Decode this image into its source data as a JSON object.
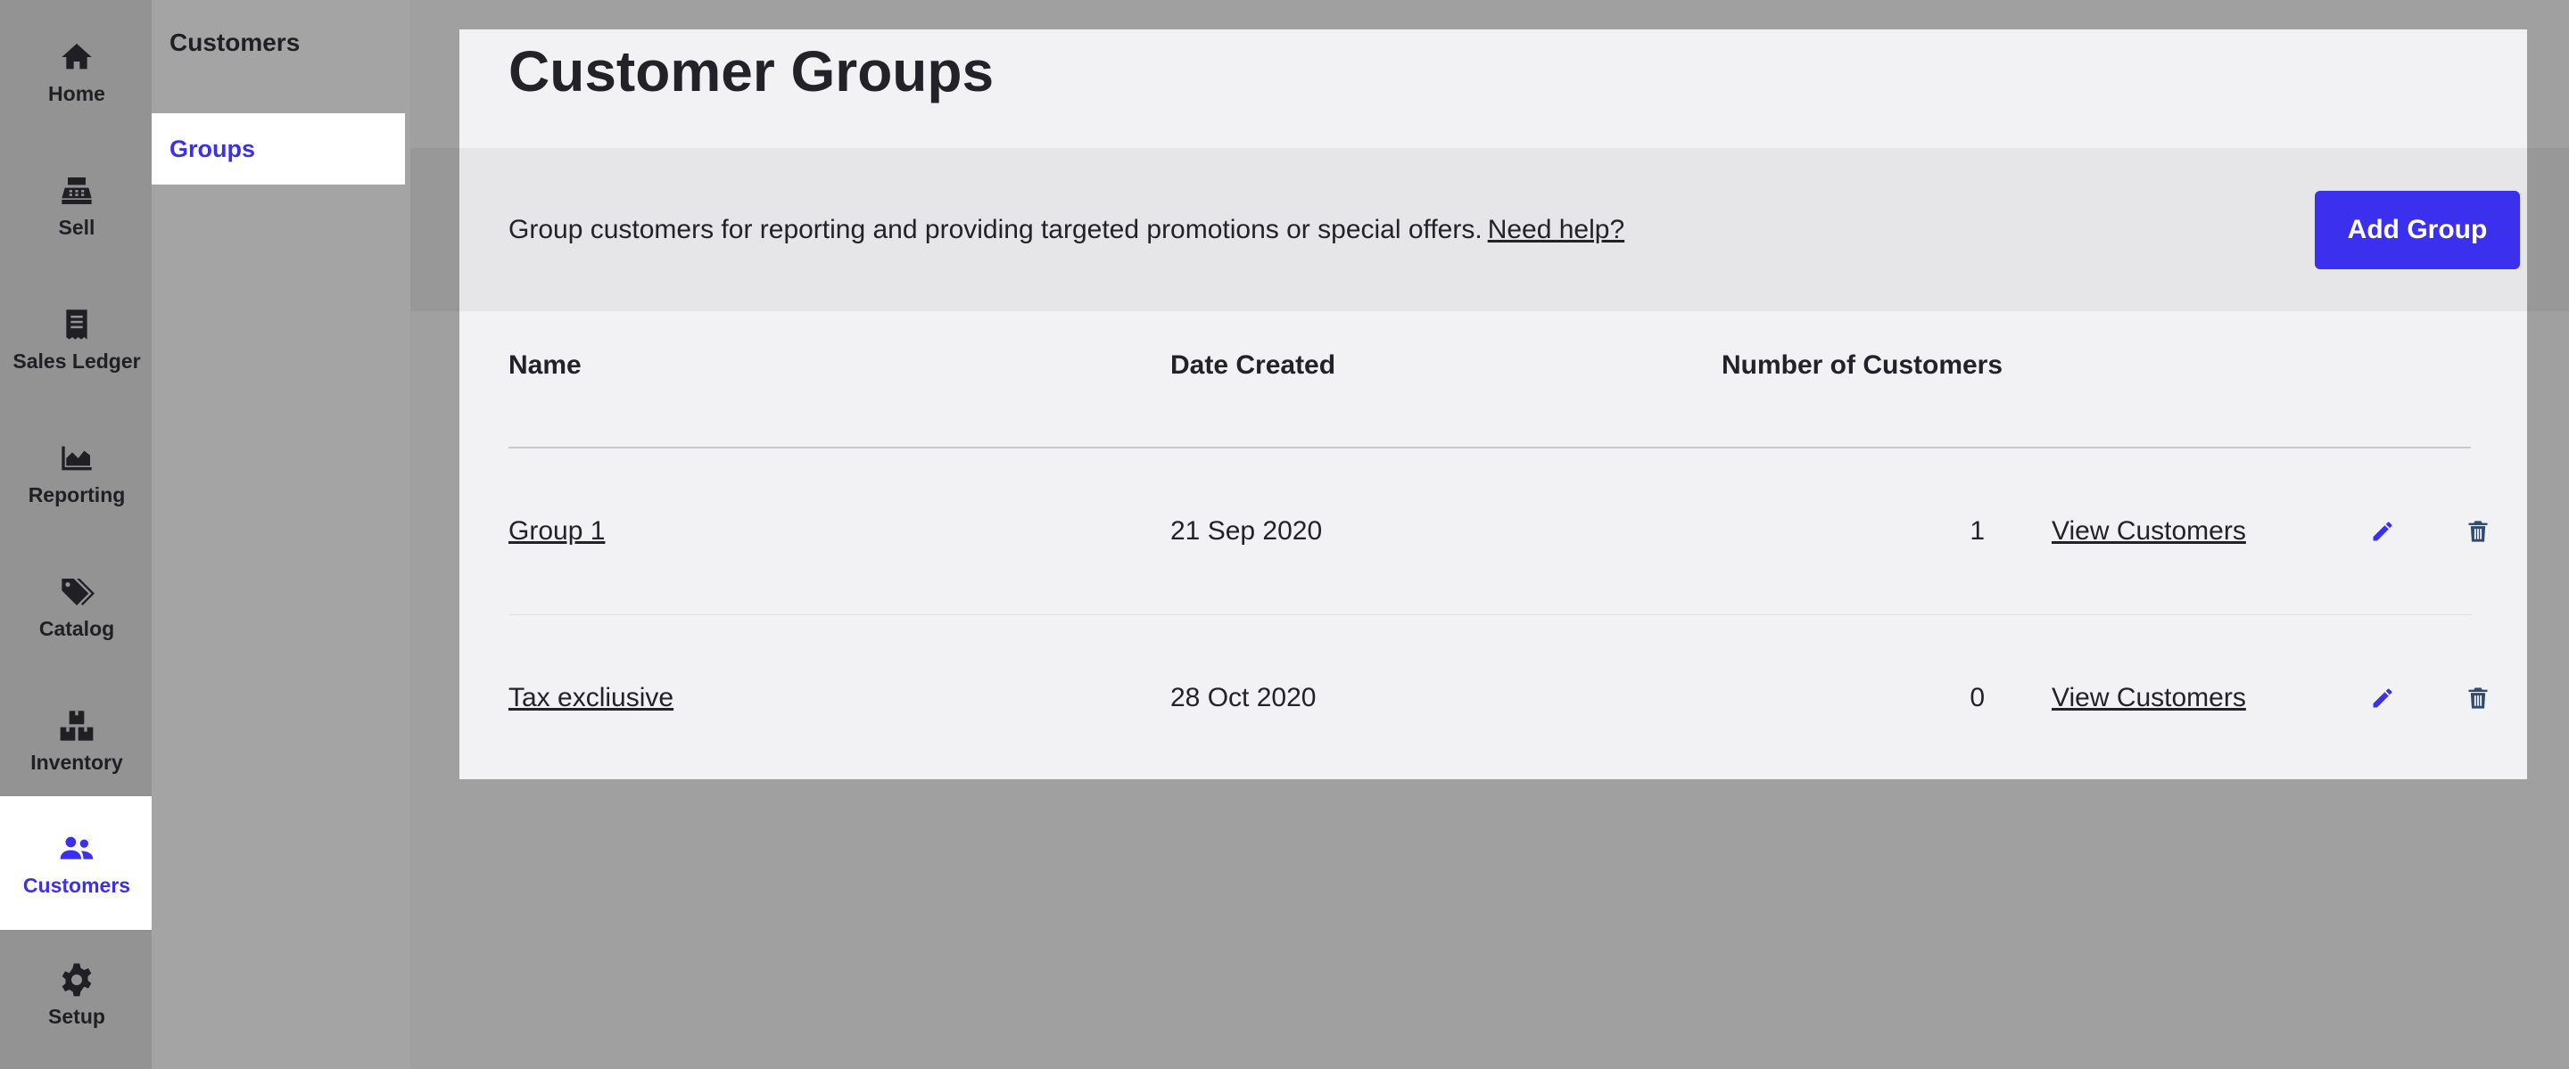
{
  "nav": {
    "items": [
      {
        "label": "Home",
        "icon": "home-icon"
      },
      {
        "label": "Sell",
        "icon": "register-icon"
      },
      {
        "label": "Sales Ledger",
        "icon": "receipt-icon"
      },
      {
        "label": "Reporting",
        "icon": "area-chart-icon"
      },
      {
        "label": "Catalog",
        "icon": "tags-icon"
      },
      {
        "label": "Inventory",
        "icon": "boxes-icon"
      },
      {
        "label": "Customers",
        "icon": "users-icon",
        "active": true
      },
      {
        "label": "Setup",
        "icon": "gear-icon"
      }
    ]
  },
  "subnav": {
    "title": "Customers",
    "items": [
      {
        "label": "Groups",
        "active": true
      }
    ]
  },
  "page": {
    "title": "Customer Groups",
    "description": "Group customers for reporting and providing targeted promotions or special offers.",
    "help_link": "Need help?",
    "add_button": "Add Group"
  },
  "table": {
    "columns": [
      "Name",
      "Date Created",
      "Number of Customers"
    ],
    "rows": [
      {
        "name": "Group 1",
        "date": "21 Sep 2020",
        "count": "1",
        "action": "View Customers"
      },
      {
        "name": "Tax excliusive",
        "date": "28 Oct 2020",
        "count": "0",
        "action": "View Customers"
      }
    ]
  },
  "colors": {
    "accent": "#3b30ee",
    "icon_action": "#3b30ee",
    "icon_delete": "#2f4b72"
  }
}
